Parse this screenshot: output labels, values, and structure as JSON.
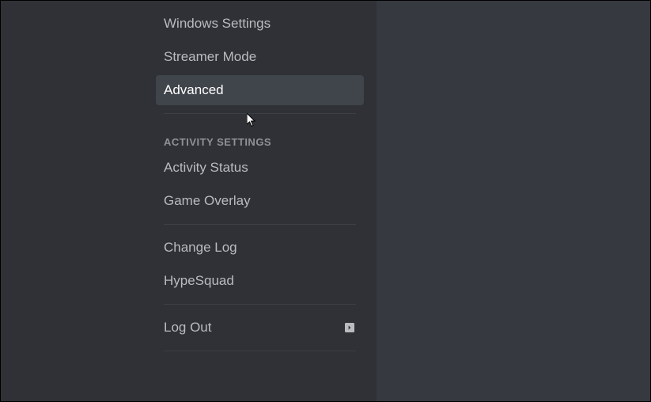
{
  "sidebar": {
    "items": [
      {
        "label": "Windows Settings",
        "selected": false
      },
      {
        "label": "Streamer Mode",
        "selected": false
      },
      {
        "label": "Advanced",
        "selected": true
      }
    ],
    "section_header": "ACTIVITY SETTINGS",
    "activity_items": [
      {
        "label": "Activity Status"
      },
      {
        "label": "Game Overlay"
      }
    ],
    "misc_items": [
      {
        "label": "Change Log"
      },
      {
        "label": "HypeSquad"
      }
    ],
    "logout_label": "Log Out"
  }
}
